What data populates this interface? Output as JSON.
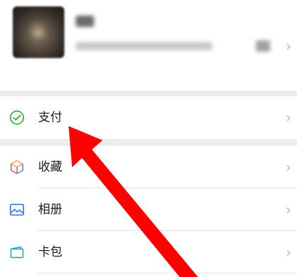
{
  "menu": {
    "pay": {
      "label": "支付",
      "icon": "wechat-pay-icon"
    },
    "favorites": {
      "label": "收藏",
      "icon": "cube-icon"
    },
    "photos": {
      "label": "相册",
      "icon": "image-icon"
    },
    "cards": {
      "label": "卡包",
      "icon": "card-wallet-icon"
    }
  },
  "colors": {
    "pay_green": "#1aad19",
    "arrow_red": "#ff0000",
    "photos_blue": "#2f6ee8",
    "cards_teal": "#19a0c8"
  }
}
